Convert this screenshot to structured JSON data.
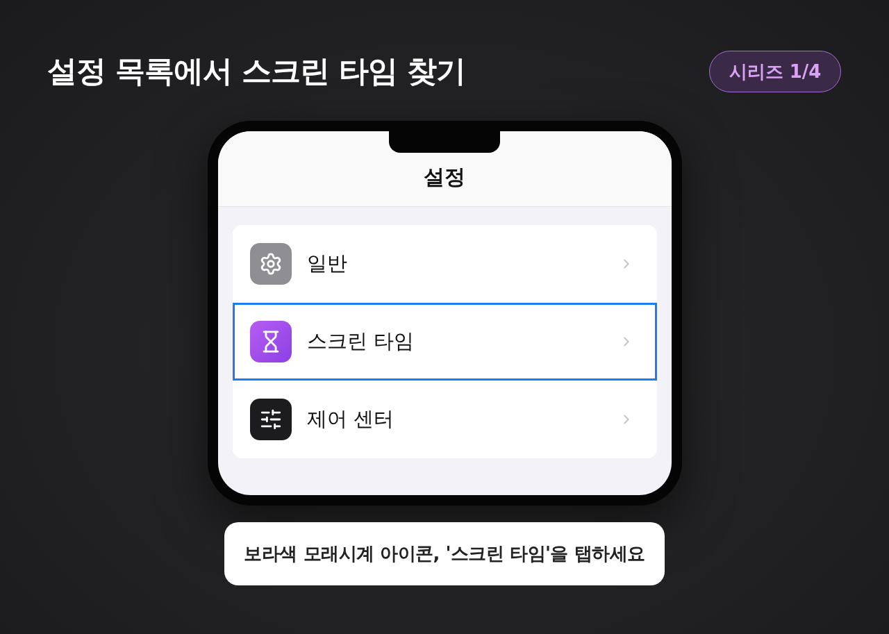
{
  "title": "설정 목록에서 스크린 타임 찾기",
  "badge": "시리즈 1/4",
  "phone": {
    "nav_title": "설정",
    "settings_items": [
      {
        "label": "일반",
        "kind": "gear",
        "selected": false
      },
      {
        "label": "스크린 타임",
        "kind": "hourglass",
        "selected": true
      },
      {
        "label": "제어 센터",
        "kind": "sliders",
        "selected": false
      }
    ]
  },
  "caption": "보라색 모래시계 아이콘, '스크린 타임'을 탭하세요"
}
